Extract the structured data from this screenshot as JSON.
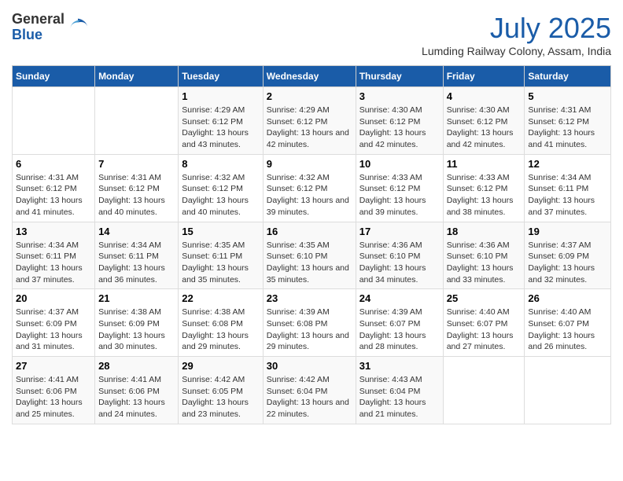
{
  "header": {
    "logo_general": "General",
    "logo_blue": "Blue",
    "month_title": "July 2025",
    "location": "Lumding Railway Colony, Assam, India"
  },
  "calendar": {
    "days_of_week": [
      "Sunday",
      "Monday",
      "Tuesday",
      "Wednesday",
      "Thursday",
      "Friday",
      "Saturday"
    ],
    "weeks": [
      [
        {
          "day": "",
          "sunrise": "",
          "sunset": "",
          "daylight": ""
        },
        {
          "day": "",
          "sunrise": "",
          "sunset": "",
          "daylight": ""
        },
        {
          "day": "1",
          "sunrise": "Sunrise: 4:29 AM",
          "sunset": "Sunset: 6:12 PM",
          "daylight": "Daylight: 13 hours and 43 minutes."
        },
        {
          "day": "2",
          "sunrise": "Sunrise: 4:29 AM",
          "sunset": "Sunset: 6:12 PM",
          "daylight": "Daylight: 13 hours and 42 minutes."
        },
        {
          "day": "3",
          "sunrise": "Sunrise: 4:30 AM",
          "sunset": "Sunset: 6:12 PM",
          "daylight": "Daylight: 13 hours and 42 minutes."
        },
        {
          "day": "4",
          "sunrise": "Sunrise: 4:30 AM",
          "sunset": "Sunset: 6:12 PM",
          "daylight": "Daylight: 13 hours and 42 minutes."
        },
        {
          "day": "5",
          "sunrise": "Sunrise: 4:31 AM",
          "sunset": "Sunset: 6:12 PM",
          "daylight": "Daylight: 13 hours and 41 minutes."
        }
      ],
      [
        {
          "day": "6",
          "sunrise": "Sunrise: 4:31 AM",
          "sunset": "Sunset: 6:12 PM",
          "daylight": "Daylight: 13 hours and 41 minutes."
        },
        {
          "day": "7",
          "sunrise": "Sunrise: 4:31 AM",
          "sunset": "Sunset: 6:12 PM",
          "daylight": "Daylight: 13 hours and 40 minutes."
        },
        {
          "day": "8",
          "sunrise": "Sunrise: 4:32 AM",
          "sunset": "Sunset: 6:12 PM",
          "daylight": "Daylight: 13 hours and 40 minutes."
        },
        {
          "day": "9",
          "sunrise": "Sunrise: 4:32 AM",
          "sunset": "Sunset: 6:12 PM",
          "daylight": "Daylight: 13 hours and 39 minutes."
        },
        {
          "day": "10",
          "sunrise": "Sunrise: 4:33 AM",
          "sunset": "Sunset: 6:12 PM",
          "daylight": "Daylight: 13 hours and 39 minutes."
        },
        {
          "day": "11",
          "sunrise": "Sunrise: 4:33 AM",
          "sunset": "Sunset: 6:12 PM",
          "daylight": "Daylight: 13 hours and 38 minutes."
        },
        {
          "day": "12",
          "sunrise": "Sunrise: 4:34 AM",
          "sunset": "Sunset: 6:11 PM",
          "daylight": "Daylight: 13 hours and 37 minutes."
        }
      ],
      [
        {
          "day": "13",
          "sunrise": "Sunrise: 4:34 AM",
          "sunset": "Sunset: 6:11 PM",
          "daylight": "Daylight: 13 hours and 37 minutes."
        },
        {
          "day": "14",
          "sunrise": "Sunrise: 4:34 AM",
          "sunset": "Sunset: 6:11 PM",
          "daylight": "Daylight: 13 hours and 36 minutes."
        },
        {
          "day": "15",
          "sunrise": "Sunrise: 4:35 AM",
          "sunset": "Sunset: 6:11 PM",
          "daylight": "Daylight: 13 hours and 35 minutes."
        },
        {
          "day": "16",
          "sunrise": "Sunrise: 4:35 AM",
          "sunset": "Sunset: 6:10 PM",
          "daylight": "Daylight: 13 hours and 35 minutes."
        },
        {
          "day": "17",
          "sunrise": "Sunrise: 4:36 AM",
          "sunset": "Sunset: 6:10 PM",
          "daylight": "Daylight: 13 hours and 34 minutes."
        },
        {
          "day": "18",
          "sunrise": "Sunrise: 4:36 AM",
          "sunset": "Sunset: 6:10 PM",
          "daylight": "Daylight: 13 hours and 33 minutes."
        },
        {
          "day": "19",
          "sunrise": "Sunrise: 4:37 AM",
          "sunset": "Sunset: 6:09 PM",
          "daylight": "Daylight: 13 hours and 32 minutes."
        }
      ],
      [
        {
          "day": "20",
          "sunrise": "Sunrise: 4:37 AM",
          "sunset": "Sunset: 6:09 PM",
          "daylight": "Daylight: 13 hours and 31 minutes."
        },
        {
          "day": "21",
          "sunrise": "Sunrise: 4:38 AM",
          "sunset": "Sunset: 6:09 PM",
          "daylight": "Daylight: 13 hours and 30 minutes."
        },
        {
          "day": "22",
          "sunrise": "Sunrise: 4:38 AM",
          "sunset": "Sunset: 6:08 PM",
          "daylight": "Daylight: 13 hours and 29 minutes."
        },
        {
          "day": "23",
          "sunrise": "Sunrise: 4:39 AM",
          "sunset": "Sunset: 6:08 PM",
          "daylight": "Daylight: 13 hours and 29 minutes."
        },
        {
          "day": "24",
          "sunrise": "Sunrise: 4:39 AM",
          "sunset": "Sunset: 6:07 PM",
          "daylight": "Daylight: 13 hours and 28 minutes."
        },
        {
          "day": "25",
          "sunrise": "Sunrise: 4:40 AM",
          "sunset": "Sunset: 6:07 PM",
          "daylight": "Daylight: 13 hours and 27 minutes."
        },
        {
          "day": "26",
          "sunrise": "Sunrise: 4:40 AM",
          "sunset": "Sunset: 6:07 PM",
          "daylight": "Daylight: 13 hours and 26 minutes."
        }
      ],
      [
        {
          "day": "27",
          "sunrise": "Sunrise: 4:41 AM",
          "sunset": "Sunset: 6:06 PM",
          "daylight": "Daylight: 13 hours and 25 minutes."
        },
        {
          "day": "28",
          "sunrise": "Sunrise: 4:41 AM",
          "sunset": "Sunset: 6:06 PM",
          "daylight": "Daylight: 13 hours and 24 minutes."
        },
        {
          "day": "29",
          "sunrise": "Sunrise: 4:42 AM",
          "sunset": "Sunset: 6:05 PM",
          "daylight": "Daylight: 13 hours and 23 minutes."
        },
        {
          "day": "30",
          "sunrise": "Sunrise: 4:42 AM",
          "sunset": "Sunset: 6:04 PM",
          "daylight": "Daylight: 13 hours and 22 minutes."
        },
        {
          "day": "31",
          "sunrise": "Sunrise: 4:43 AM",
          "sunset": "Sunset: 6:04 PM",
          "daylight": "Daylight: 13 hours and 21 minutes."
        },
        {
          "day": "",
          "sunrise": "",
          "sunset": "",
          "daylight": ""
        },
        {
          "day": "",
          "sunrise": "",
          "sunset": "",
          "daylight": ""
        }
      ]
    ]
  }
}
